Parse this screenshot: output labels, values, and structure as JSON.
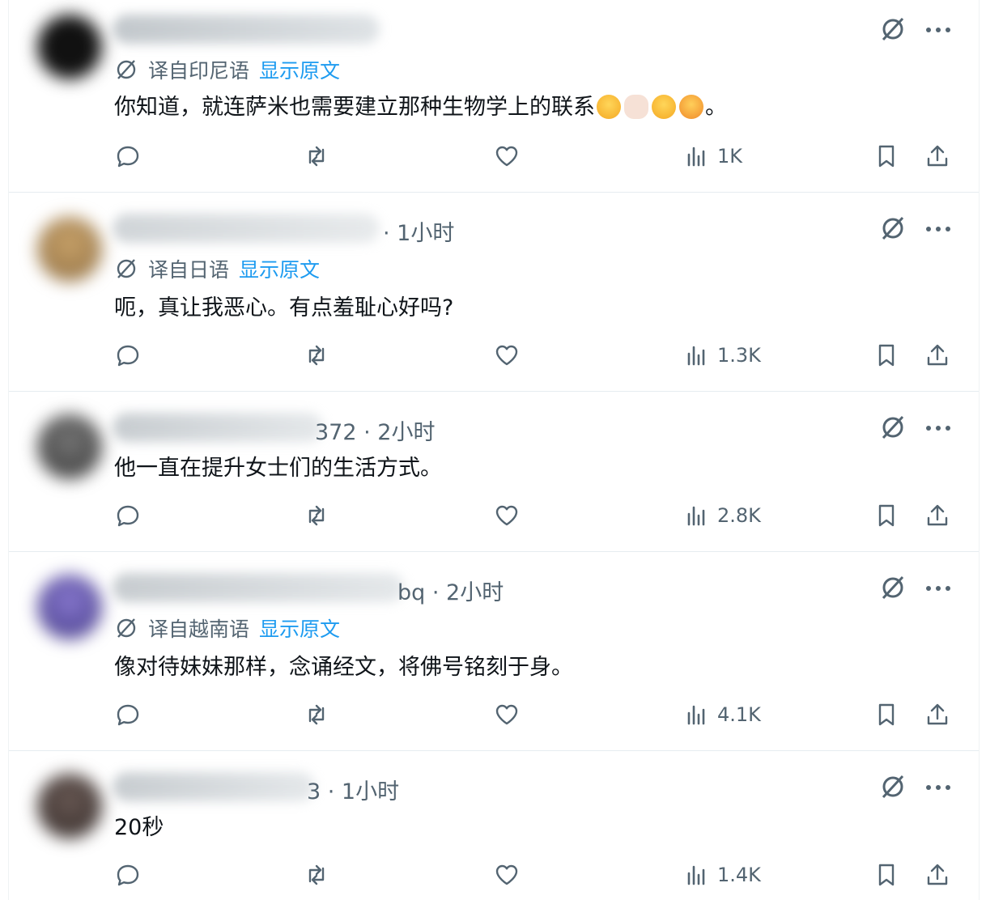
{
  "colors": {
    "text": "#0f1419",
    "muted": "#536471",
    "link": "#1d9bf0",
    "border": "#e6ecf0"
  },
  "replies": [
    {
      "meta": "",
      "translation": {
        "label": "译自印尼语",
        "link": "显示原文"
      },
      "text": "你知道，就连萨米也需要建立那种生物学上的联系",
      "emoji_after": [
        "face-with-tears-of-joy",
        "pointing-hand",
        "rolling-on-floor-laughing",
        "face-with-hand-over-mouth"
      ],
      "text_end": "。",
      "views": "1K"
    },
    {
      "meta": "· 1小时",
      "translation": {
        "label": "译自日语",
        "link": "显示原文"
      },
      "text": "呃，真让我恶心。有点羞耻心好吗?",
      "views": "1.3K"
    },
    {
      "meta": "372 · 2小时",
      "text": "他一直在提升女士们的生活方式。",
      "views": "2.8K"
    },
    {
      "meta": "bq · 2小时",
      "translation": {
        "label": "译自越南语",
        "link": "显示原文"
      },
      "text": "像对待妹妹那样，念诵经文，将佛号铭刻于身。",
      "views": "4.1K"
    },
    {
      "meta": "3 · 1小时",
      "text": "20秒",
      "views": "1.4K"
    }
  ],
  "icons": {
    "reply": "reply-icon",
    "retweet": "retweet-icon",
    "like": "heart-icon",
    "views": "views-icon",
    "bookmark": "bookmark-icon",
    "share": "share-icon",
    "grok": "grok-icon",
    "more": "more-icon",
    "translate": "translate-icon"
  }
}
